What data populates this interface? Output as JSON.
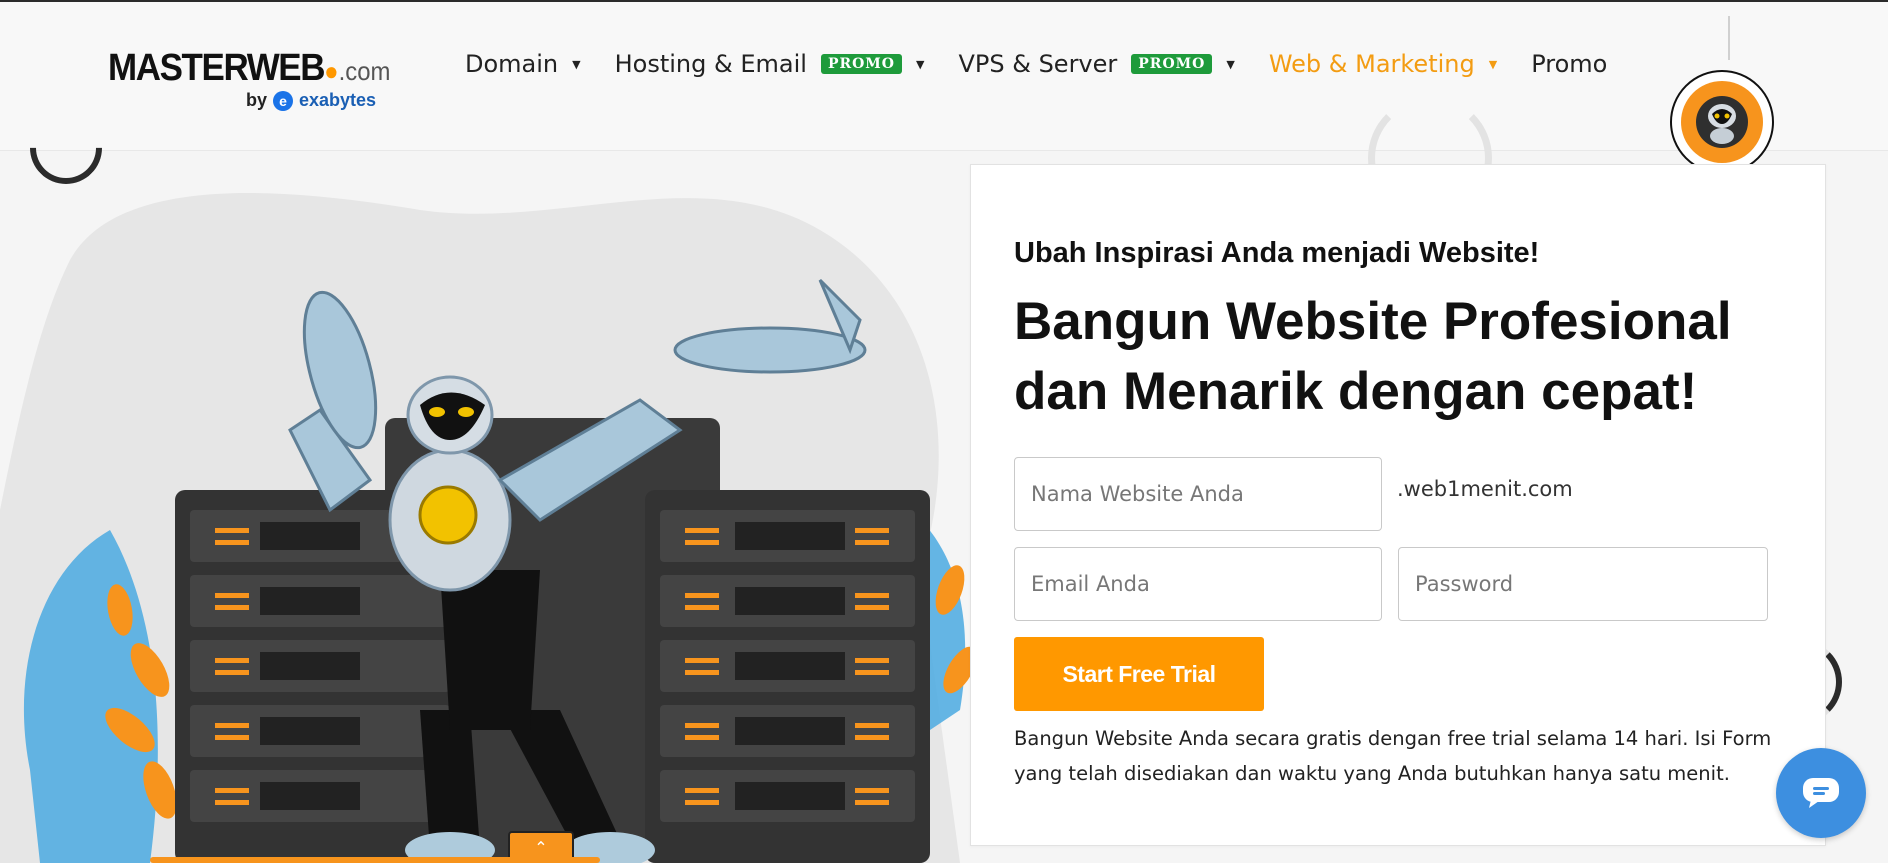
{
  "brand": {
    "name": "MASTERWEB",
    "tld": ".com",
    "byline_prefix": "by",
    "partner": "exabytes",
    "partner_glyph": "e"
  },
  "nav": {
    "items": [
      {
        "label": "Domain",
        "badge": "",
        "has_dropdown": true,
        "active": false
      },
      {
        "label": "Hosting & Email",
        "badge": "PROMO",
        "has_dropdown": true,
        "active": false
      },
      {
        "label": "VPS & Server",
        "badge": "PROMO",
        "has_dropdown": true,
        "active": false
      },
      {
        "label": "Web & Marketing",
        "badge": "",
        "has_dropdown": true,
        "active": true
      },
      {
        "label": "Promo",
        "badge": "",
        "has_dropdown": false,
        "active": false
      }
    ],
    "caret_glyph": "▼"
  },
  "hero": {
    "eyebrow": "Ubah Inspirasi Anda menjadi Website!",
    "headline": "Bangun Website Profesional dan Menarik dengan cepat!",
    "form": {
      "website_placeholder": "Nama Website Anda",
      "domain_suffix": ".web1menit.com",
      "email_placeholder": "Email Anda",
      "password_placeholder": "Password",
      "submit_label": "Start Free Trial"
    },
    "description": "Bangun Website Anda secara gratis dengan free trial selama 14 hari. Isi Form yang telah disediakan dan waktu yang Anda butuhkan hanya satu menit."
  },
  "widgets": {
    "scroll_top_glyph": "⌃",
    "chat_icon": "chat-bubble-icon",
    "avatar_icon": "robot-avatar-icon"
  },
  "colors": {
    "accent": "#ff9800",
    "promo_badge": "#1e9b3b",
    "chat": "#3d8fe0",
    "text": "#111111"
  }
}
